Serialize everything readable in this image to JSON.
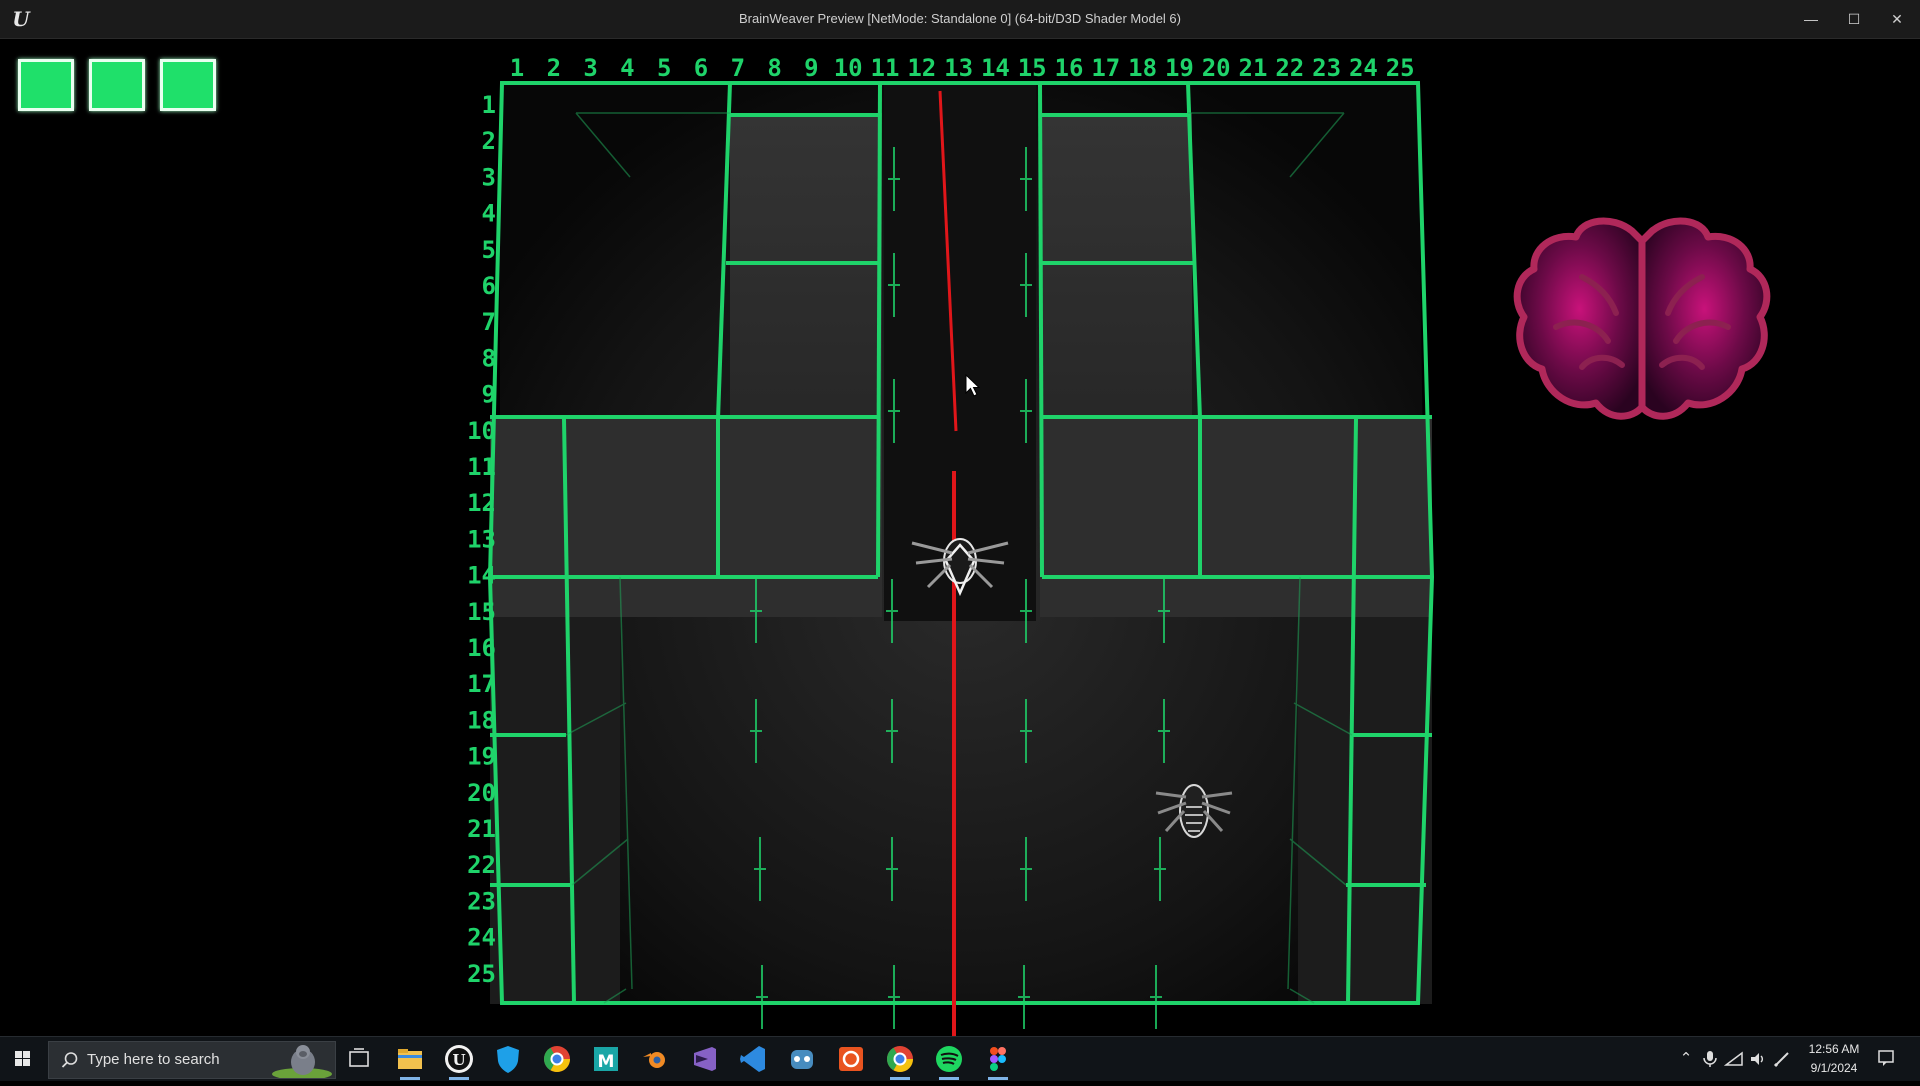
{
  "window": {
    "title": "BrainWeaver Preview [NetMode: Standalone 0]  (64-bit/D3D Shader Model 6)",
    "app_icon": "unreal-engine-logo",
    "minimize_glyph": "—",
    "maximize_glyph": "☐",
    "close_glyph": "✕"
  },
  "hud": {
    "lives": 3,
    "life_color": "#1fe06a",
    "brain_icon": "brain-icon",
    "cursor_icon": "mouse-pointer-icon"
  },
  "grid": {
    "columns": [
      "1",
      "2",
      "3",
      "4",
      "5",
      "6",
      "7",
      "8",
      "9",
      "10",
      "11",
      "12",
      "13",
      "14",
      "15",
      "16",
      "17",
      "18",
      "19",
      "20",
      "21",
      "22",
      "23",
      "24",
      "25"
    ],
    "rows": [
      "1",
      "2",
      "3",
      "4",
      "5",
      "6",
      "7",
      "8",
      "9",
      "10",
      "11",
      "12",
      "13",
      "14",
      "15",
      "16",
      "17",
      "18",
      "19",
      "20",
      "21",
      "22",
      "23",
      "24",
      "25"
    ],
    "line_color": "#1fd36a",
    "laser_color": "#e0161a"
  },
  "taskbar": {
    "search_placeholder": "Type here to search",
    "pinned": [
      {
        "name": "task-view-icon"
      },
      {
        "name": "file-explorer-icon"
      },
      {
        "name": "unreal-engine-icon"
      },
      {
        "name": "security-shield-icon"
      },
      {
        "name": "chrome-icon"
      },
      {
        "name": "maya-icon"
      },
      {
        "name": "blender-icon"
      },
      {
        "name": "visual-studio-icon"
      },
      {
        "name": "vscode-icon"
      },
      {
        "name": "godot-icon"
      },
      {
        "name": "ubuntu-icon"
      },
      {
        "name": "chrome-2-icon"
      },
      {
        "name": "spotify-icon"
      },
      {
        "name": "figma-icon"
      }
    ],
    "tray": {
      "time": "12:56 AM",
      "date": "9/1/2024"
    }
  }
}
